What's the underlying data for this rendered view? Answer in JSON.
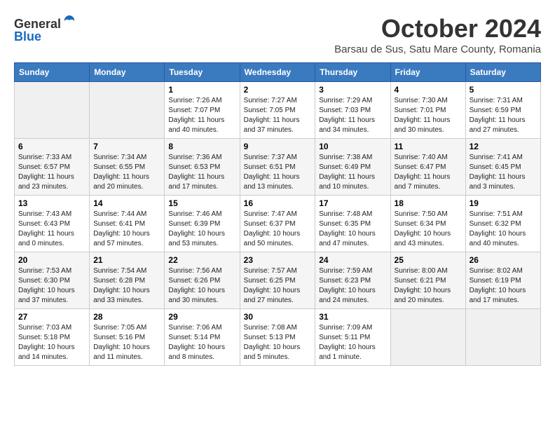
{
  "header": {
    "logo_line1": "General",
    "logo_line2": "Blue",
    "month": "October 2024",
    "location": "Barsau de Sus, Satu Mare County, Romania"
  },
  "weekdays": [
    "Sunday",
    "Monday",
    "Tuesday",
    "Wednesday",
    "Thursday",
    "Friday",
    "Saturday"
  ],
  "weeks": [
    [
      {
        "day": "",
        "info": ""
      },
      {
        "day": "",
        "info": ""
      },
      {
        "day": "1",
        "info": "Sunrise: 7:26 AM\nSunset: 7:07 PM\nDaylight: 11 hours and 40 minutes."
      },
      {
        "day": "2",
        "info": "Sunrise: 7:27 AM\nSunset: 7:05 PM\nDaylight: 11 hours and 37 minutes."
      },
      {
        "day": "3",
        "info": "Sunrise: 7:29 AM\nSunset: 7:03 PM\nDaylight: 11 hours and 34 minutes."
      },
      {
        "day": "4",
        "info": "Sunrise: 7:30 AM\nSunset: 7:01 PM\nDaylight: 11 hours and 30 minutes."
      },
      {
        "day": "5",
        "info": "Sunrise: 7:31 AM\nSunset: 6:59 PM\nDaylight: 11 hours and 27 minutes."
      }
    ],
    [
      {
        "day": "6",
        "info": "Sunrise: 7:33 AM\nSunset: 6:57 PM\nDaylight: 11 hours and 23 minutes."
      },
      {
        "day": "7",
        "info": "Sunrise: 7:34 AM\nSunset: 6:55 PM\nDaylight: 11 hours and 20 minutes."
      },
      {
        "day": "8",
        "info": "Sunrise: 7:36 AM\nSunset: 6:53 PM\nDaylight: 11 hours and 17 minutes."
      },
      {
        "day": "9",
        "info": "Sunrise: 7:37 AM\nSunset: 6:51 PM\nDaylight: 11 hours and 13 minutes."
      },
      {
        "day": "10",
        "info": "Sunrise: 7:38 AM\nSunset: 6:49 PM\nDaylight: 11 hours and 10 minutes."
      },
      {
        "day": "11",
        "info": "Sunrise: 7:40 AM\nSunset: 6:47 PM\nDaylight: 11 hours and 7 minutes."
      },
      {
        "day": "12",
        "info": "Sunrise: 7:41 AM\nSunset: 6:45 PM\nDaylight: 11 hours and 3 minutes."
      }
    ],
    [
      {
        "day": "13",
        "info": "Sunrise: 7:43 AM\nSunset: 6:43 PM\nDaylight: 11 hours and 0 minutes."
      },
      {
        "day": "14",
        "info": "Sunrise: 7:44 AM\nSunset: 6:41 PM\nDaylight: 10 hours and 57 minutes."
      },
      {
        "day": "15",
        "info": "Sunrise: 7:46 AM\nSunset: 6:39 PM\nDaylight: 10 hours and 53 minutes."
      },
      {
        "day": "16",
        "info": "Sunrise: 7:47 AM\nSunset: 6:37 PM\nDaylight: 10 hours and 50 minutes."
      },
      {
        "day": "17",
        "info": "Sunrise: 7:48 AM\nSunset: 6:35 PM\nDaylight: 10 hours and 47 minutes."
      },
      {
        "day": "18",
        "info": "Sunrise: 7:50 AM\nSunset: 6:34 PM\nDaylight: 10 hours and 43 minutes."
      },
      {
        "day": "19",
        "info": "Sunrise: 7:51 AM\nSunset: 6:32 PM\nDaylight: 10 hours and 40 minutes."
      }
    ],
    [
      {
        "day": "20",
        "info": "Sunrise: 7:53 AM\nSunset: 6:30 PM\nDaylight: 10 hours and 37 minutes."
      },
      {
        "day": "21",
        "info": "Sunrise: 7:54 AM\nSunset: 6:28 PM\nDaylight: 10 hours and 33 minutes."
      },
      {
        "day": "22",
        "info": "Sunrise: 7:56 AM\nSunset: 6:26 PM\nDaylight: 10 hours and 30 minutes."
      },
      {
        "day": "23",
        "info": "Sunrise: 7:57 AM\nSunset: 6:25 PM\nDaylight: 10 hours and 27 minutes."
      },
      {
        "day": "24",
        "info": "Sunrise: 7:59 AM\nSunset: 6:23 PM\nDaylight: 10 hours and 24 minutes."
      },
      {
        "day": "25",
        "info": "Sunrise: 8:00 AM\nSunset: 6:21 PM\nDaylight: 10 hours and 20 minutes."
      },
      {
        "day": "26",
        "info": "Sunrise: 8:02 AM\nSunset: 6:19 PM\nDaylight: 10 hours and 17 minutes."
      }
    ],
    [
      {
        "day": "27",
        "info": "Sunrise: 7:03 AM\nSunset: 5:18 PM\nDaylight: 10 hours and 14 minutes."
      },
      {
        "day": "28",
        "info": "Sunrise: 7:05 AM\nSunset: 5:16 PM\nDaylight: 10 hours and 11 minutes."
      },
      {
        "day": "29",
        "info": "Sunrise: 7:06 AM\nSunset: 5:14 PM\nDaylight: 10 hours and 8 minutes."
      },
      {
        "day": "30",
        "info": "Sunrise: 7:08 AM\nSunset: 5:13 PM\nDaylight: 10 hours and 5 minutes."
      },
      {
        "day": "31",
        "info": "Sunrise: 7:09 AM\nSunset: 5:11 PM\nDaylight: 10 hours and 1 minute."
      },
      {
        "day": "",
        "info": ""
      },
      {
        "day": "",
        "info": ""
      }
    ]
  ]
}
